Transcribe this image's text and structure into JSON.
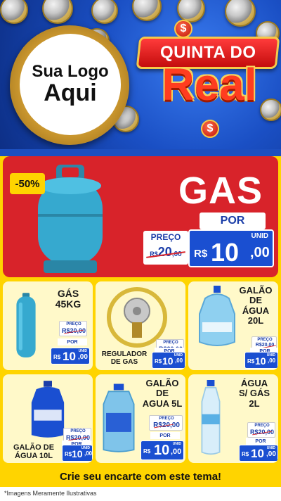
{
  "header": {
    "logo_line1": "Sua Logo",
    "logo_line2": "Aqui",
    "campaign_line1": "QUINTA DO",
    "campaign_line2": "Real",
    "currency_symbol": "$"
  },
  "main_promo": {
    "discount": "-50%",
    "title": "GAS",
    "por_label": "POR",
    "preco_label": "PREÇO",
    "old_currency": "R$",
    "old_value": "20",
    "old_cents": ",00",
    "currency": "R$",
    "value": "10",
    "cents": ",00",
    "unit": "UNID"
  },
  "products": [
    {
      "title_lines": [
        "GÁS",
        "45KG"
      ],
      "preco_label": "PREÇO",
      "old_value": "R$20,00",
      "por_label": "POR",
      "currency": "R$",
      "value": "10",
      "cents": ",00",
      "unit": "UNID"
    },
    {
      "title_lines": [
        "REGULADOR",
        "DE GAS"
      ],
      "preco_label": "PREÇO",
      "old_value": "R$20,00",
      "por_label": "POR",
      "currency": "R$",
      "value": "10",
      "cents": ",00",
      "unit": "UNID"
    },
    {
      "title_lines": [
        "GALÃO",
        "DE",
        "ÁGUA",
        "20L"
      ],
      "preco_label": "PREÇO",
      "old_value": "R$20,00",
      "por_label": "POR",
      "currency": "R$",
      "value": "10",
      "cents": ",00",
      "unit": "UNID"
    },
    {
      "title_lines": [
        "GALÃO DE",
        "ÁGUA 10L"
      ],
      "preco_label": "PREÇO",
      "old_value": "R$20,00",
      "por_label": "POR",
      "currency": "R$",
      "value": "10",
      "cents": ",00",
      "unit": "UNID"
    },
    {
      "title_lines": [
        "GALÃO",
        "DE",
        "AGUA 5L"
      ],
      "preco_label": "PREÇO",
      "old_value": "R$20,00",
      "por_label": "POR",
      "currency": "R$",
      "value": "10",
      "cents": ",00",
      "unit": "UNID"
    },
    {
      "title_lines": [
        "ÁGUA",
        "S/ GÁS",
        "2L"
      ],
      "preco_label": "PREÇO",
      "old_value": "R$20,00",
      "por_label": "POR",
      "currency": "R$",
      "value": "10",
      "cents": ",00",
      "unit": "UNID"
    }
  ],
  "footer": {
    "cta": "Crie seu encarte com este tema!",
    "disclaimer": "*Imagens Meramente Ilustrativas"
  },
  "colors": {
    "header_blue": "#1a4fc4",
    "promo_red": "#d8232a",
    "accent_yellow": "#ffd400",
    "price_blue": "#1a4fd1"
  }
}
